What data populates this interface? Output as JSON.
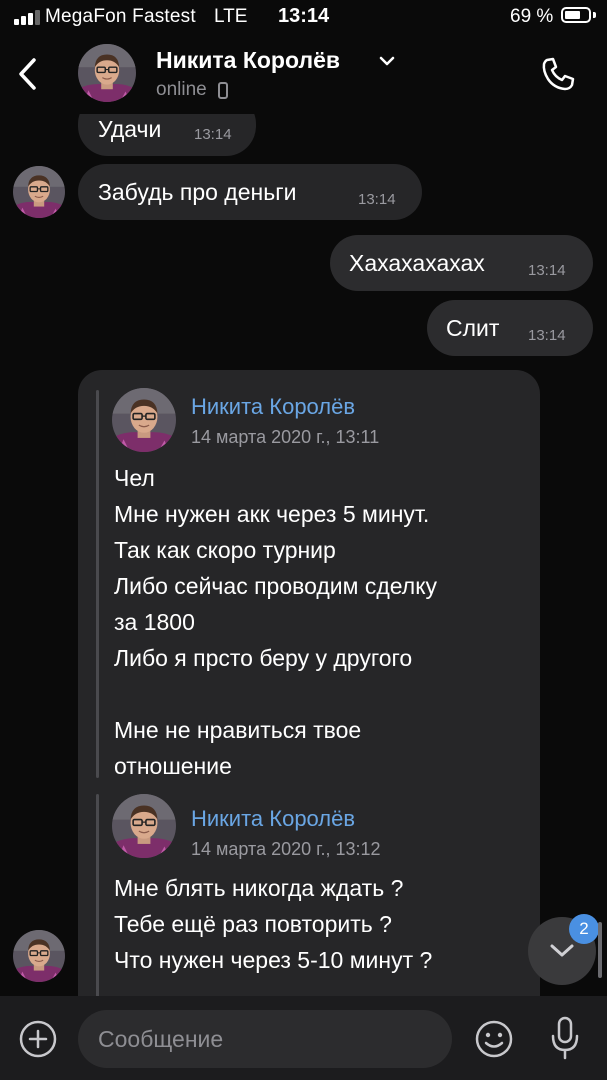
{
  "status_bar": {
    "carrier": "MegaFon Fastest",
    "network": "LTE",
    "time": "13:14",
    "battery_percent": "69 %",
    "battery_level": 0.69,
    "signal_bars": 3
  },
  "header": {
    "contact_name": "Никита Королёв",
    "status": "online"
  },
  "messages": [
    {
      "direction": "in",
      "text": "Удачи",
      "time": "13:14"
    },
    {
      "direction": "in",
      "text": "Забудь про деньги",
      "time": "13:14"
    },
    {
      "direction": "out",
      "text": "Хахахахахах",
      "time": "13:14"
    },
    {
      "direction": "out",
      "text": "Слит",
      "time": "13:14"
    }
  ],
  "forwarded": [
    {
      "author": "Никита Королёв",
      "date": "14 марта 2020 г., 13:11",
      "text": "Чел\nМне нужен акк через 5 минут.\nТак как скоро турнир\nЛибо сейчас проводим сделку\nза 1800\nЛибо я прсто беру у другого\n\nМне не нравиться твое\nотношение"
    },
    {
      "author": "Никита Королёв",
      "date": "14 марта 2020 г., 13:12",
      "text": "Мне блять никогда ждать ?\nТебе ещё раз повторить ?\nЧто нужен через 5-10 минут ?"
    }
  ],
  "unread_count": "2",
  "composer": {
    "placeholder": "Сообщение"
  },
  "colors": {
    "background": "#0a0a0a",
    "bubble": "#262628",
    "accent_link": "#6aa6e4",
    "badge": "#4a90e2"
  },
  "icons": [
    "back-icon",
    "chevron-down-icon",
    "phone-icon",
    "call-icon",
    "chevron-down-icon",
    "plus-icon",
    "emoji-icon",
    "microphone-icon"
  ]
}
